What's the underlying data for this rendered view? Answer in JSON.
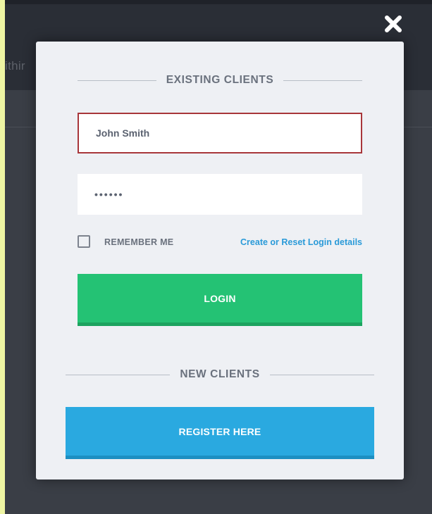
{
  "backdrop": {
    "header_partial_text": "ithir"
  },
  "close": {
    "icon": "close-icon"
  },
  "existing_clients": {
    "heading": "EXISTING CLIENTS",
    "username_value": "John Smith",
    "password_value": "••••••",
    "remember_label": "REMEMBER ME",
    "remember_checked": false,
    "reset_link": "Create or Reset Login details",
    "login_button": "LOGIN"
  },
  "new_clients": {
    "heading": "NEW CLIENTS",
    "register_button": "REGISTER HERE"
  },
  "colors": {
    "login_button": "#24c274",
    "register_button": "#2aa9e0",
    "link": "#2a9ad8",
    "error_border": "#a8363a"
  }
}
